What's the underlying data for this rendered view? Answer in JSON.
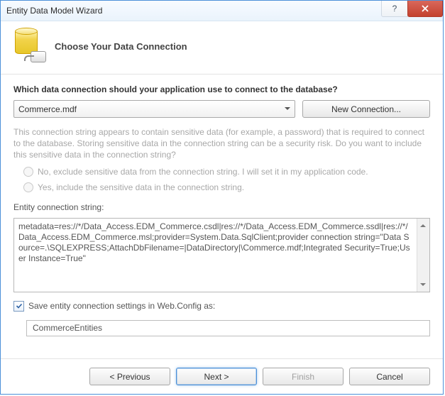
{
  "window": {
    "title": "Entity Data Model Wizard"
  },
  "header": {
    "heading": "Choose Your Data Connection"
  },
  "question": "Which data connection should your application use to connect to the database?",
  "connection": {
    "selected": "Commerce.mdf",
    "new_button": "New Connection..."
  },
  "warning": "This connection string appears to contain sensitive data (for example, a password) that is required to connect to the database. Storing sensitive data in the connection string can be a security risk. Do you want to include this sensitive data in the connection string?",
  "options": {
    "exclude": "No, exclude sensitive data from the connection string. I will set it in my application code.",
    "include": "Yes, include the sensitive data in the connection string."
  },
  "entity_label": "Entity connection string:",
  "entity_string": "metadata=res://*/Data_Access.EDM_Commerce.csdl|res://*/Data_Access.EDM_Commerce.ssdl|res://*/Data_Access.EDM_Commerce.msl;provider=System.Data.SqlClient;provider connection string=\"Data Source=.\\SQLEXPRESS;AttachDbFilename=|DataDirectory|\\Commerce.mdf;Integrated Security=True;User Instance=True\"",
  "save": {
    "checkbox_label": "Save entity connection settings in Web.Config as:",
    "value": "CommerceEntities",
    "checked": true
  },
  "buttons": {
    "previous": "< Previous",
    "next": "Next >",
    "finish": "Finish",
    "cancel": "Cancel"
  }
}
